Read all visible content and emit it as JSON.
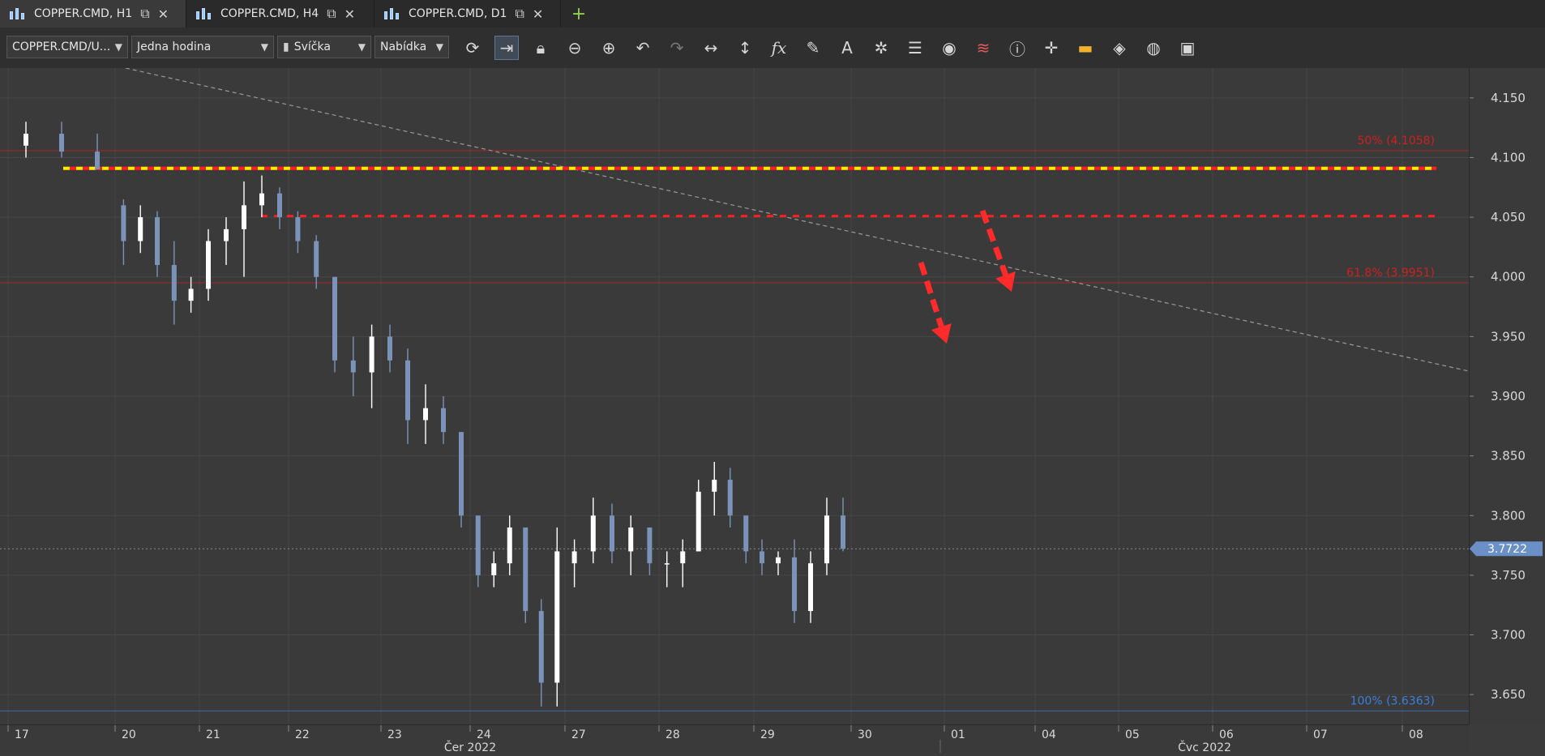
{
  "tabs": [
    {
      "label": "COPPER.CMD, H1",
      "active": true
    },
    {
      "label": "COPPER.CMD, H4",
      "active": false
    },
    {
      "label": "COPPER.CMD, D1",
      "active": false
    }
  ],
  "toolbar": {
    "instrument": "COPPER.CMD/U...",
    "period": "Jedna hodina",
    "chart_type": "Svíčka",
    "side": "Nabídka",
    "tools": [
      "refresh-icon",
      "autoshift-icon",
      "lock-icon",
      "zoom-reset-icon",
      "zoom-icon",
      "undo-icon",
      "redo-icon",
      "horizontal-resize-icon",
      "vertical-resize-icon",
      "indicator-fx-icon",
      "pencil-icon",
      "text-icon",
      "objects-icon",
      "layers-icon",
      "eye-icon",
      "pattern-icon",
      "info-icon",
      "crosshair-icon",
      "ohlc-bar-icon",
      "paint-bucket-icon",
      "theme-icon",
      "save-icon"
    ]
  },
  "chart_data": {
    "type": "candlestick",
    "symbol": "COPPER.CMD",
    "timeframe": "H1",
    "y_ticks": [
      "4.150",
      "4.100",
      "4.050",
      "4.000",
      "3.950",
      "3.900",
      "3.850",
      "3.800",
      "3.750",
      "3.700",
      "3.650"
    ],
    "ylim": [
      3.625,
      4.175
    ],
    "x_ticks": [
      "17",
      "20",
      "21",
      "22",
      "23",
      "24",
      "27",
      "28",
      "29",
      "30",
      "01",
      "04",
      "05",
      "06",
      "07",
      "08"
    ],
    "month_labels": [
      "Čer 2022",
      "Čvc 2022"
    ],
    "current_price": "3.7722",
    "fib_levels": [
      {
        "label": "50% (4.1058)",
        "value": 4.1058,
        "color": "#d02020"
      },
      {
        "label": "61.8% (3.9951)",
        "value": 3.9951,
        "color": "#d02020"
      },
      {
        "label": "100% (3.6363)",
        "value": 3.6363,
        "color": "#3d7fd8"
      }
    ],
    "horizontal_lines": [
      {
        "value": 4.091,
        "color": "#ffea00",
        "style": "dashed"
      },
      {
        "value": 4.051,
        "color": "#ff2020",
        "style": "dashed"
      }
    ],
    "trendline": {
      "from": {
        "date": "17",
        "price": 4.175
      },
      "to": {
        "date": "08",
        "price": 3.921
      },
      "color": "#9a9a9a"
    },
    "annotations": [
      {
        "type": "arrow",
        "direction": "down",
        "color": "#ff2a2a"
      },
      {
        "type": "arrow",
        "direction": "down",
        "color": "#ff2a2a"
      }
    ],
    "candles": [
      {
        "date": "17",
        "o": 4.11,
        "h": 4.13,
        "l": 4.1,
        "c": 4.12
      },
      {
        "date": "17",
        "o": 4.12,
        "h": 4.13,
        "l": 4.1,
        "c": 4.105
      },
      {
        "date": "17",
        "o": 4.105,
        "h": 4.12,
        "l": 4.09,
        "c": 4.09
      },
      {
        "date": "20",
        "o": 4.06,
        "h": 4.065,
        "l": 4.01,
        "c": 4.03
      },
      {
        "date": "20",
        "o": 4.03,
        "h": 4.06,
        "l": 4.02,
        "c": 4.05
      },
      {
        "date": "20",
        "o": 4.05,
        "h": 4.055,
        "l": 4.0,
        "c": 4.01
      },
      {
        "date": "20",
        "o": 4.01,
        "h": 4.03,
        "l": 3.96,
        "c": 3.98
      },
      {
        "date": "20",
        "o": 3.98,
        "h": 4.0,
        "l": 3.97,
        "c": 3.99
      },
      {
        "date": "21",
        "o": 3.99,
        "h": 4.04,
        "l": 3.98,
        "c": 4.03
      },
      {
        "date": "21",
        "o": 4.03,
        "h": 4.05,
        "l": 4.01,
        "c": 4.04
      },
      {
        "date": "21",
        "o": 4.04,
        "h": 4.08,
        "l": 4.0,
        "c": 4.06
      },
      {
        "date": "21",
        "o": 4.06,
        "h": 4.085,
        "l": 4.05,
        "c": 4.07
      },
      {
        "date": "21",
        "o": 4.07,
        "h": 4.075,
        "l": 4.04,
        "c": 4.05
      },
      {
        "date": "22",
        "o": 4.05,
        "h": 4.055,
        "l": 4.02,
        "c": 4.03
      },
      {
        "date": "22",
        "o": 4.03,
        "h": 4.035,
        "l": 3.99,
        "c": 4.0
      },
      {
        "date": "22",
        "o": 4.0,
        "h": 4.0,
        "l": 3.92,
        "c": 3.93
      },
      {
        "date": "22",
        "o": 3.93,
        "h": 3.95,
        "l": 3.9,
        "c": 3.92
      },
      {
        "date": "22",
        "o": 3.92,
        "h": 3.96,
        "l": 3.89,
        "c": 3.95
      },
      {
        "date": "23",
        "o": 3.95,
        "h": 3.96,
        "l": 3.92,
        "c": 3.93
      },
      {
        "date": "23",
        "o": 3.93,
        "h": 3.94,
        "l": 3.86,
        "c": 3.88
      },
      {
        "date": "23",
        "o": 3.88,
        "h": 3.91,
        "l": 3.86,
        "c": 3.89
      },
      {
        "date": "23",
        "o": 3.89,
        "h": 3.9,
        "l": 3.86,
        "c": 3.87
      },
      {
        "date": "23",
        "o": 3.87,
        "h": 3.87,
        "l": 3.79,
        "c": 3.8
      },
      {
        "date": "24",
        "o": 3.8,
        "h": 3.8,
        "l": 3.74,
        "c": 3.75
      },
      {
        "date": "24",
        "o": 3.75,
        "h": 3.77,
        "l": 3.74,
        "c": 3.76
      },
      {
        "date": "24",
        "o": 3.76,
        "h": 3.8,
        "l": 3.75,
        "c": 3.79
      },
      {
        "date": "24",
        "o": 3.79,
        "h": 3.79,
        "l": 3.71,
        "c": 3.72
      },
      {
        "date": "24",
        "o": 3.72,
        "h": 3.73,
        "l": 3.64,
        "c": 3.66
      },
      {
        "date": "24",
        "o": 3.66,
        "h": 3.79,
        "l": 3.64,
        "c": 3.77
      },
      {
        "date": "27",
        "o": 3.76,
        "h": 3.78,
        "l": 3.74,
        "c": 3.77
      },
      {
        "date": "27",
        "o": 3.77,
        "h": 3.815,
        "l": 3.76,
        "c": 3.8
      },
      {
        "date": "27",
        "o": 3.8,
        "h": 3.81,
        "l": 3.76,
        "c": 3.77
      },
      {
        "date": "27",
        "o": 3.77,
        "h": 3.8,
        "l": 3.75,
        "c": 3.79
      },
      {
        "date": "27",
        "o": 3.79,
        "h": 3.79,
        "l": 3.75,
        "c": 3.76
      },
      {
        "date": "28",
        "o": 3.76,
        "h": 3.77,
        "l": 3.74,
        "c": 3.76
      },
      {
        "date": "28",
        "o": 3.76,
        "h": 3.78,
        "l": 3.74,
        "c": 3.77
      },
      {
        "date": "28",
        "o": 3.77,
        "h": 3.83,
        "l": 3.77,
        "c": 3.82
      },
      {
        "date": "28",
        "o": 3.82,
        "h": 3.845,
        "l": 3.8,
        "c": 3.83
      },
      {
        "date": "28",
        "o": 3.83,
        "h": 3.84,
        "l": 3.79,
        "c": 3.8
      },
      {
        "date": "28",
        "o": 3.8,
        "h": 3.8,
        "l": 3.76,
        "c": 3.77
      },
      {
        "date": "29",
        "o": 3.77,
        "h": 3.78,
        "l": 3.75,
        "c": 3.76
      },
      {
        "date": "29",
        "o": 3.76,
        "h": 3.77,
        "l": 3.75,
        "c": 3.765
      },
      {
        "date": "29",
        "o": 3.765,
        "h": 3.78,
        "l": 3.71,
        "c": 3.72
      },
      {
        "date": "29",
        "o": 3.72,
        "h": 3.77,
        "l": 3.71,
        "c": 3.76
      },
      {
        "date": "29",
        "o": 3.76,
        "h": 3.815,
        "l": 3.75,
        "c": 3.8
      },
      {
        "date": "29",
        "o": 3.8,
        "h": 3.815,
        "l": 3.77,
        "c": 3.7722
      }
    ]
  }
}
